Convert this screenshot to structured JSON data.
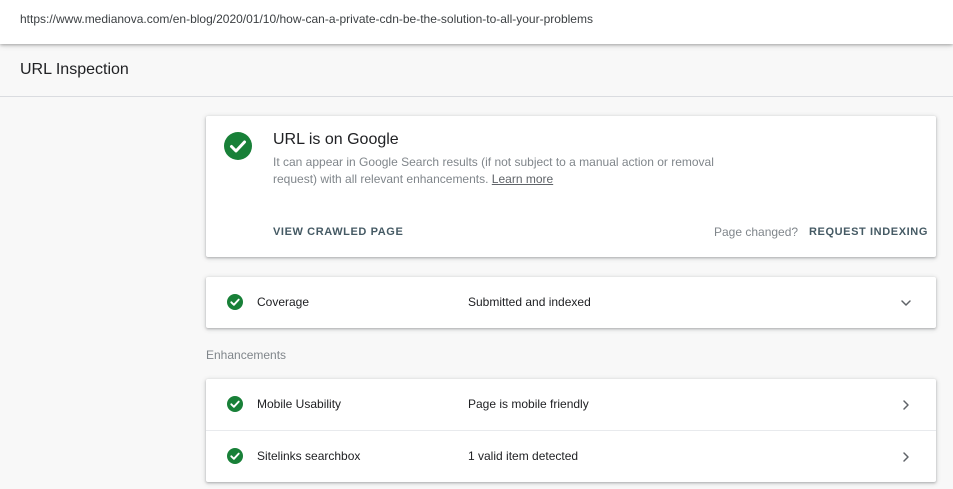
{
  "url_bar": {
    "url": "https://www.medianova.com/en-blog/2020/01/10/how-can-a-private-cdn-be-the-solution-to-all-your-problems"
  },
  "header": {
    "title": "URL Inspection"
  },
  "status": {
    "title": "URL is on Google",
    "description": "It can appear in Google Search results (if not subject to a manual action or removal request) with all relevant enhancements.",
    "learn_more": "Learn more",
    "view_crawled_label": "VIEW CRAWLED PAGE",
    "page_changed_text": "Page changed?",
    "request_indexing_label": "REQUEST INDEXING",
    "icon": "check-circle-icon"
  },
  "coverage": {
    "label": "Coverage",
    "value": "Submitted and indexed",
    "icon": "check-circle-icon",
    "toggle_icon": "chevron-down-icon"
  },
  "enhancements": {
    "section_label": "Enhancements",
    "items": [
      {
        "label": "Mobile Usability",
        "value": "Page is mobile friendly",
        "icon": "check-circle-icon",
        "toggle_icon": "chevron-right-icon"
      },
      {
        "label": "Sitelinks searchbox",
        "value": "1 valid item detected",
        "icon": "check-circle-icon",
        "toggle_icon": "chevron-right-icon"
      }
    ]
  },
  "colors": {
    "success_green": "#188038",
    "action_text": "#455a64",
    "muted_text": "#80868b",
    "page_background": "#f8f8f8"
  }
}
